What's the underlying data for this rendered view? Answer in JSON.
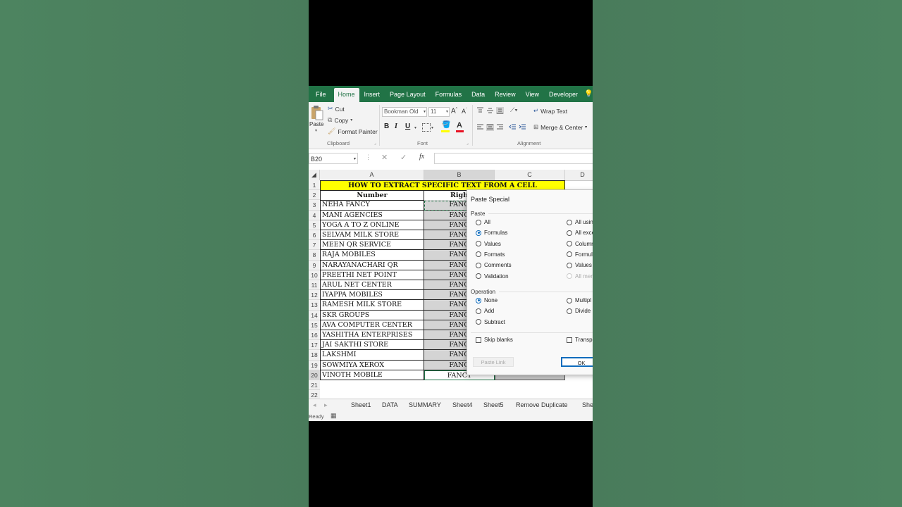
{
  "menu": {
    "tabs": [
      "File",
      "Home",
      "Insert",
      "Page Layout",
      "Formulas",
      "Data",
      "Review",
      "View",
      "Developer"
    ],
    "active": "Home"
  },
  "ribbon": {
    "clipboard": {
      "paste": "Paste",
      "cut": "Cut",
      "copy": "Copy",
      "format_painter": "Format Painter",
      "label": "Clipboard"
    },
    "font": {
      "name": "Bookman Old",
      "size": "11",
      "label": "Font"
    },
    "alignment": {
      "wrap_text": "Wrap Text",
      "merge_center": "Merge & Center",
      "label": "Alignment"
    }
  },
  "formula_bar": {
    "name_box": "B20",
    "fx": "fx"
  },
  "sheet": {
    "columns": [
      "A",
      "B",
      "C",
      "D"
    ],
    "title": "HOW TO EXTRACT SPECIFIC TEXT FROM A CELL",
    "header_a": "Number",
    "header_b": "Righ",
    "rows": [
      {
        "n": "1"
      },
      {
        "n": "2"
      },
      {
        "n": "3",
        "a": "NEHA FANCY",
        "b": "FANC"
      },
      {
        "n": "4",
        "a": "MANI AGENCIES",
        "b": "FANC"
      },
      {
        "n": "5",
        "a": "YOGA A TO Z ONLINE",
        "b": "FANC"
      },
      {
        "n": "6",
        "a": "SELVAM MILK STORE",
        "b": "FANC"
      },
      {
        "n": "7",
        "a": "MEEN QR SERVICE",
        "b": "FANC"
      },
      {
        "n": "8",
        "a": "RAJA MOBILES",
        "b": "FANC"
      },
      {
        "n": "9",
        "a": "NARAYANACHARI QR",
        "b": "FANC"
      },
      {
        "n": "10",
        "a": "PREETHI NET POINT",
        "b": "FANC"
      },
      {
        "n": "11",
        "a": "ARUL NET CENTER",
        "b": "FANC"
      },
      {
        "n": "12",
        "a": "IYAPPA MOBILES",
        "b": "FANC"
      },
      {
        "n": "13",
        "a": "RAMESH MILK STORE",
        "b": "FANC"
      },
      {
        "n": "14",
        "a": "SKR GROUPS",
        "b": "FANC"
      },
      {
        "n": "15",
        "a": "AVA COMPUTER CENTER",
        "b": "FANC"
      },
      {
        "n": "16",
        "a": "YASHITHA ENTERPRISES",
        "b": "FANC"
      },
      {
        "n": "17",
        "a": "JAI SAKTHI STORE",
        "b": "FANC"
      },
      {
        "n": "18",
        "a": "LAKSHMI",
        "b": "FANC"
      },
      {
        "n": "19",
        "a": "SOWMIYA XEROX",
        "b": "FANC"
      },
      {
        "n": "20",
        "a": "VINOTH MOBILE",
        "b": "FANCY"
      },
      {
        "n": "21"
      },
      {
        "n": "22"
      }
    ]
  },
  "sheet_tabs": [
    "Sheet1",
    "DATA",
    "SUMMARY",
    "Sheet4",
    "Sheet5",
    "Remove Duplicate",
    "She"
  ],
  "status": "Ready",
  "dialog": {
    "title": "Paste Special",
    "paste_label": "Paste",
    "paste_left": [
      "All",
      "Formulas",
      "Values",
      "Formats",
      "Comments",
      "Validation"
    ],
    "paste_right": [
      "All usin",
      "All exce",
      "Column",
      "Formul",
      "Values",
      "All mer"
    ],
    "paste_selected": "Formulas",
    "operation_label": "Operation",
    "operation_left": [
      "None",
      "Add",
      "Subtract"
    ],
    "operation_right": [
      "Multipl",
      "Divide"
    ],
    "operation_selected": "None",
    "skip_blanks": "Skip blanks",
    "transpose": "Transpo",
    "paste_link": "Paste Link",
    "ok": "OK"
  }
}
